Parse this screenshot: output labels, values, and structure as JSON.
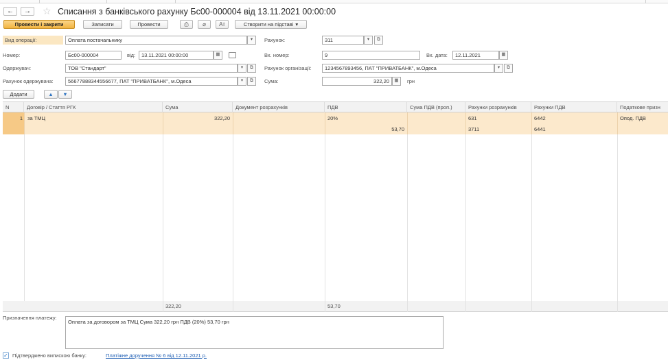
{
  "window": {
    "back_glyph": "←",
    "forward_glyph": "→",
    "favorite_glyph": "☆",
    "title": "Списання з банківського рахунку Бс00-000004 від 13.11.2021 00:00:00"
  },
  "toolbar": {
    "post_and_close": "Провести і закрити",
    "save": "Записати",
    "post": "Провести",
    "print_icon_glyph": "⎙",
    "attach_icon_glyph": "⌀",
    "structure_icon_glyph": "Ат",
    "create_based_on": "Створити на підставі",
    "dropdown_glyph": "▾"
  },
  "form": {
    "operation_label": "Вид операції:",
    "operation_value": "Оплата постачальнику",
    "account_label": "Рахунок:",
    "account_value": "311",
    "number_label": "Номер:",
    "number_value": "Бс00-000004",
    "date_label": "від:",
    "date_value": "13.11.2021 00:00:00",
    "in_number_label": "Вх. номер:",
    "in_number_value": "9",
    "in_date_label": "Вх. дата:",
    "in_date_value": "12.11.2021",
    "recipient_label": "Одержувач:",
    "recipient_value": "ТОВ \"Стандарт\"",
    "org_account_label": "Рахунок організації:",
    "org_account_value": "1234567893456, ПАТ \"ПРИВАТБАНК\", м.Одеса",
    "recipient_account_label": "Рахунок одержувача:",
    "recipient_account_value": "56677888344556677, ПАТ \"ПРИВАТБАНК\", м.Одеса",
    "sum_label": "Сума:",
    "sum_value": "322,20",
    "currency": "грн",
    "calendar_glyph": "▦",
    "open_glyph": "⧉",
    "select_glyph": "▾"
  },
  "table_toolbar": {
    "add": "Додати",
    "up_glyph": "▲",
    "down_glyph": "▼"
  },
  "table": {
    "columns": [
      "N",
      "Договір / Стаття РГК",
      "Сума",
      "Документ розрахунків",
      "ПДВ",
      "Сума ПДВ (проп.)",
      "Рахунки розрахунків",
      "Рахунки ПДВ",
      "Податкове призн"
    ],
    "rows": [
      {
        "n": "1",
        "contract": "за ТМЦ",
        "sum": "322,20",
        "settlement_doc": "",
        "vat": "20%",
        "vat_amount": "53,70",
        "vat_prop": "",
        "settlement_accounts_1": "631",
        "settlement_accounts_2": "3711",
        "vat_accounts_1": "6442",
        "vat_accounts_2": "6441",
        "tax": "Опод. ПДВ"
      }
    ],
    "totals": {
      "sum": "322,20",
      "vat": "53,70"
    }
  },
  "footer": {
    "purpose_label": "Призначення платежу:",
    "purpose_value": "Оплата за договором за ТМЦ Сума 322,20 грн ПДВ (20%) 53,70 грн",
    "confirmed_label": "Підтверджено випискою банку:",
    "confirmed_checked_glyph": "✓",
    "payment_link": "Платіжне доручення № 6 від 12.11.2021 р."
  }
}
